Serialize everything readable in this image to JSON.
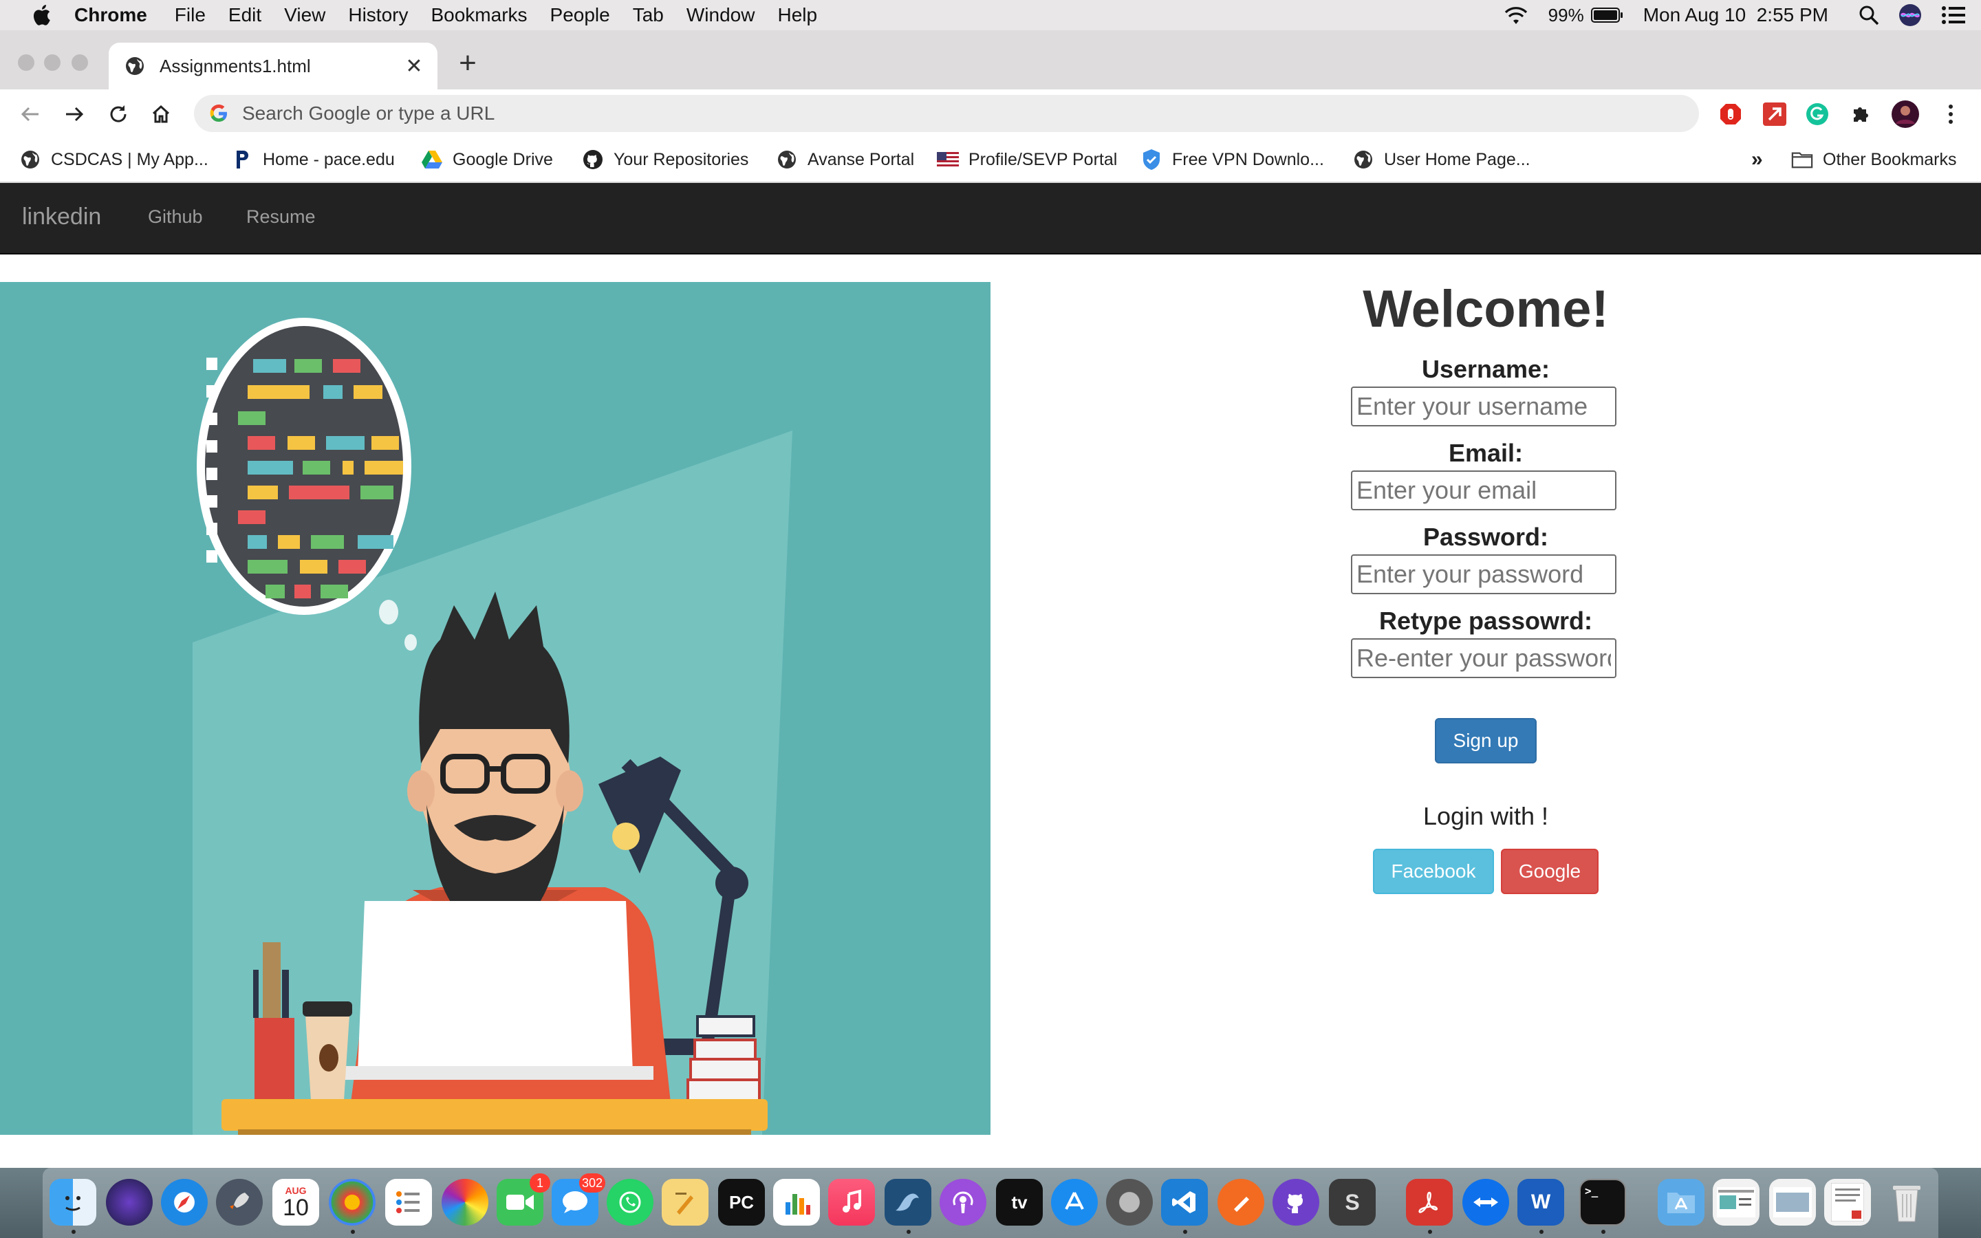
{
  "menubar": {
    "app_name": "Chrome",
    "items": [
      "File",
      "Edit",
      "View",
      "History",
      "Bookmarks",
      "People",
      "Tab",
      "Window",
      "Help"
    ],
    "battery": "99%",
    "datetime": "Mon Aug 10  2:55 PM"
  },
  "tab": {
    "title": "Assignments1.html",
    "close": "✕",
    "new_tab": "+"
  },
  "omnibox": {
    "placeholder": "Search Google or type a URL"
  },
  "bookmarks": {
    "items": [
      "CSDCAS | My App...",
      "Home - pace.edu",
      "Google Drive",
      "Your Repositories",
      "Avanse Portal",
      "Profile/SEVP Portal",
      "Free VPN Downlo...",
      "User Home Page..."
    ],
    "overflow": "»",
    "other": "Other Bookmarks"
  },
  "navbar": {
    "brand": "linkedin",
    "links": [
      "Github",
      "Resume"
    ]
  },
  "form": {
    "title": "Welcome!",
    "username_label": "Username:",
    "username_placeholder": "Enter your username",
    "email_label": "Email:",
    "email_placeholder": "Enter your email",
    "password_label": "Password:",
    "password_placeholder": "Enter your password",
    "retype_label": "Retype passowrd:",
    "retype_placeholder": "Re-enter your password",
    "signup_label": "Sign up",
    "login_with": "Login with !",
    "facebook_label": "Facebook",
    "google_label": "Google"
  },
  "dock": {
    "calendar_month": "AUG",
    "calendar_day": "10",
    "facetime_badge": "1",
    "messages_badge": "302",
    "pycharm_label": "PC",
    "appletv_label": "tv",
    "s_label": "S",
    "word_label": "W",
    "terminal_label": ">_"
  },
  "colors": {
    "navbar_bg": "#222222",
    "illustration_bg": "#5eb3b1",
    "signup": "#337ab7",
    "facebook": "#5bc0de",
    "google": "#d9534f"
  }
}
